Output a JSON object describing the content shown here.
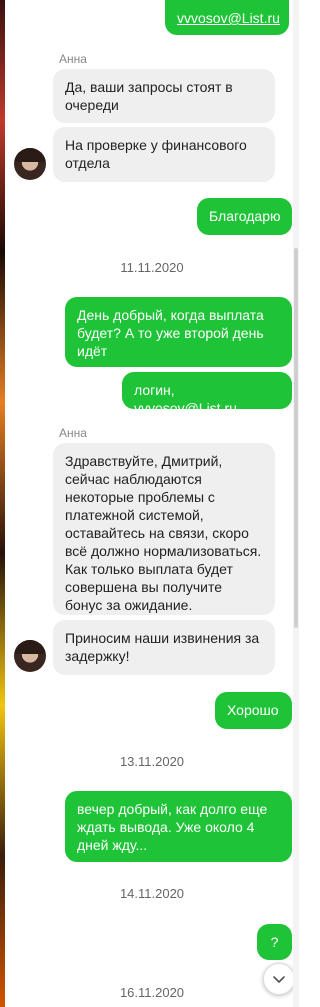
{
  "messages": {
    "m1": {
      "prefix": "",
      "link": "vvvosov@List.ru"
    },
    "sender1": "Анна",
    "m2": "Да, ваши запросы стоят в очереди",
    "m3": "На проверке у финансового отдела",
    "m4": "Благодарю",
    "date1": "11.11.2020",
    "m5": "День добрый, когда выплата будет? А то уже второй день идёт",
    "m6": {
      "prefix": "логин, ",
      "link": "vvvosov@List.ru"
    },
    "sender2": "Анна",
    "m7": "Здравствуйте, Дмитрий, сейчас наблюдаются некоторые проблемы с платежной системой, оставайтесь на связи, скоро всё должно нормализоваться. Как только выплата будет совершена вы получите бонус за ожидание.",
    "m8": "Приносим наши извинения за задержку!",
    "m9": "Хорошо",
    "date2": "13.11.2020",
    "m10": "вечер добрый, как долго еще ждать вывода. Уже около 4 дней жду...",
    "date3": "14.11.2020",
    "m11": "?",
    "date4": "16.11.2020"
  },
  "icons": {
    "scroll_down": "chevron-down-icon",
    "avatar": "avatar-anna"
  },
  "colors": {
    "outgoing": "#1ec337",
    "incoming": "#efefef"
  }
}
